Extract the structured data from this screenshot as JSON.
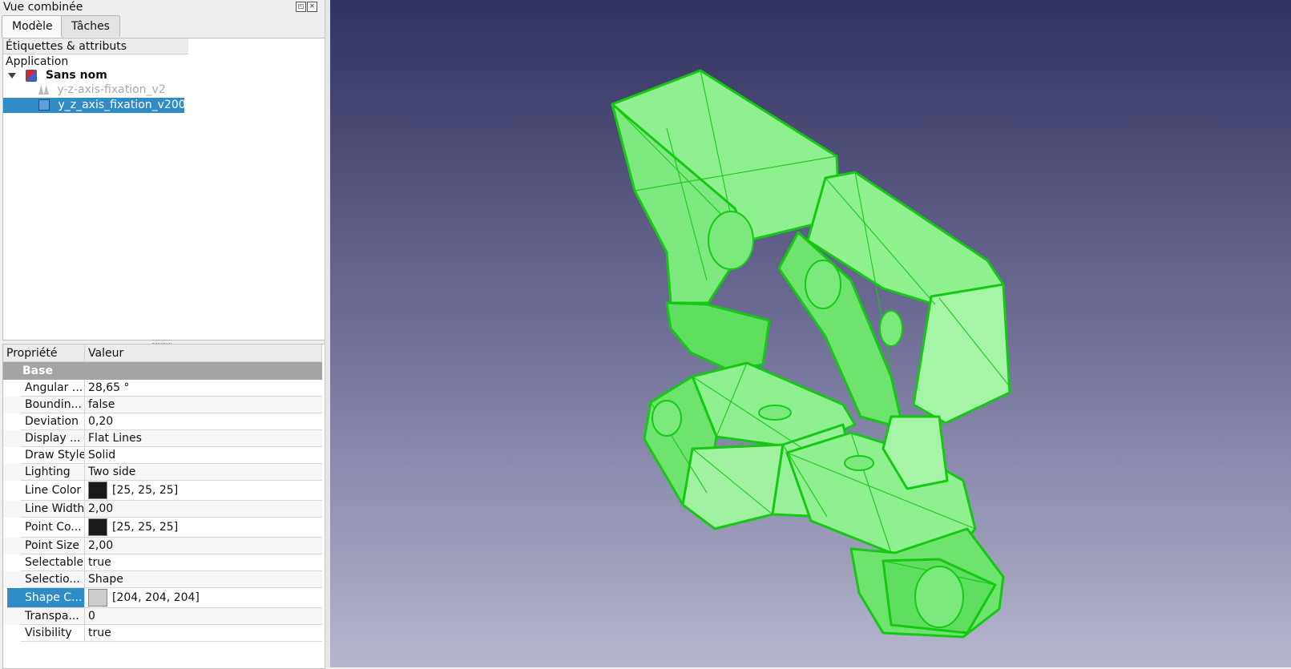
{
  "panel": {
    "title": "Vue combinée",
    "float_btn": "◰",
    "close_btn": "✕"
  },
  "tabs": [
    "Modèle",
    "Tâches"
  ],
  "tree": {
    "header": "Étiquettes & attributs",
    "root_label": "Application",
    "document": "Sans nom",
    "items": [
      "y-z-axis-fixation_v2",
      "y_z_axis_fixation_v2001"
    ],
    "selected_index": 1
  },
  "properties": {
    "col_property": "Propriété",
    "col_value": "Valeur",
    "group": "Base",
    "rows": [
      {
        "name": "Angular ...",
        "value": "28,65 °"
      },
      {
        "name": "Boundin...",
        "value": "false"
      },
      {
        "name": "Deviation",
        "value": "0,20"
      },
      {
        "name": "Display ...",
        "value": "Flat Lines"
      },
      {
        "name": "Draw Style",
        "value": "Solid"
      },
      {
        "name": "Lighting",
        "value": "Two side"
      },
      {
        "name": "Line Color",
        "value": "[25, 25, 25]",
        "color": "#191919"
      },
      {
        "name": "Line Width",
        "value": "2,00"
      },
      {
        "name": "Point Co...",
        "value": "[25, 25, 25]",
        "color": "#191919"
      },
      {
        "name": "Point Size",
        "value": "2,00"
      },
      {
        "name": "Selectable",
        "value": "true"
      },
      {
        "name": "Selectio...",
        "value": "Shape"
      },
      {
        "name": "Shape C...",
        "value": "[204, 204, 204]",
        "color": "#cccccc",
        "selected": true
      },
      {
        "name": "Transpa...",
        "value": "0"
      },
      {
        "name": "Visibility",
        "value": "true"
      }
    ]
  },
  "colors": {
    "selection": "#308cc6",
    "model_green": "#1ed21e",
    "viewport_top": "#32325f",
    "viewport_bottom": "#b6b6ce"
  }
}
